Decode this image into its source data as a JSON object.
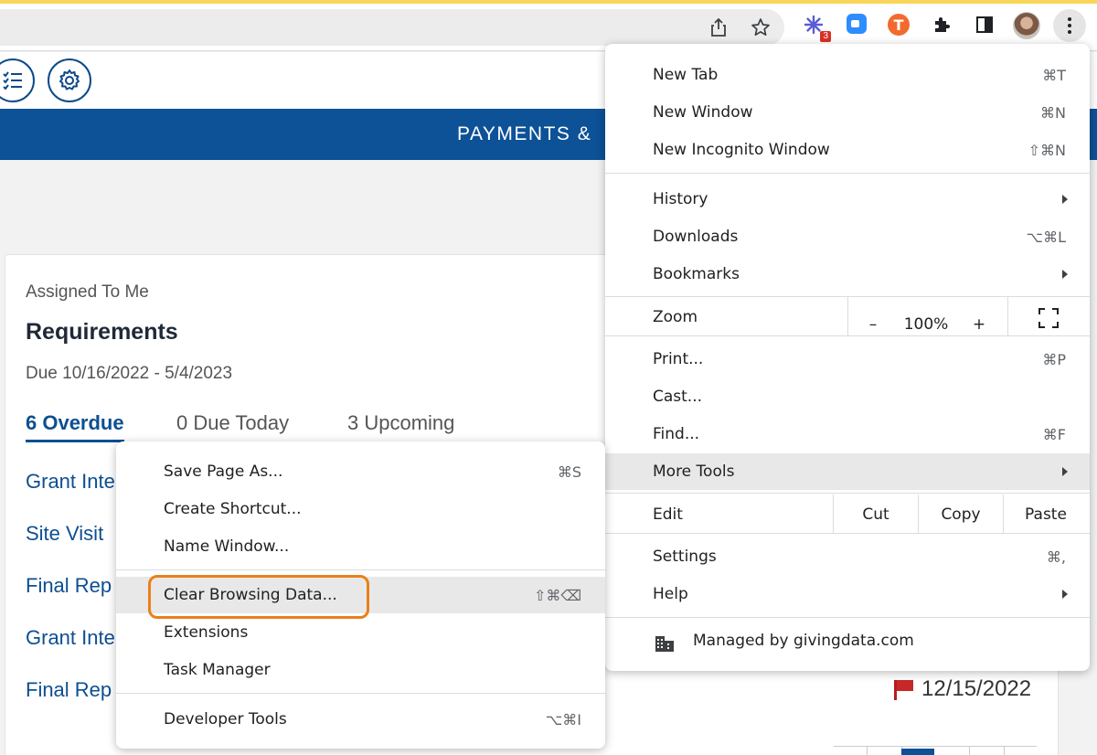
{
  "browser": {
    "extension_badge": "3",
    "extension_letter": "T"
  },
  "page": {
    "banner_title": "PAYMENTS &",
    "assigned_label": "Assigned To Me",
    "section_title": "Requirements",
    "due_range": "Due 10/16/2022 - 5/4/2023",
    "tabs": [
      "6 Overdue",
      "0 Due Today",
      "3 Upcoming"
    ],
    "items": [
      "Grant Inte",
      "Site Visit",
      "Final Rep",
      "Grant Inte",
      "Final Rep"
    ],
    "flag_date": "12/15/2022"
  },
  "menu": {
    "new_tab": {
      "label": "New Tab",
      "shortcut": "⌘T"
    },
    "new_window": {
      "label": "New Window",
      "shortcut": "⌘N"
    },
    "new_incognito": {
      "label": "New Incognito Window",
      "shortcut": "⇧⌘N"
    },
    "history": {
      "label": "History"
    },
    "downloads": {
      "label": "Downloads",
      "shortcut": "⌥⌘L"
    },
    "bookmarks": {
      "label": "Bookmarks"
    },
    "zoom": {
      "label": "Zoom",
      "minus": "–",
      "level": "100%",
      "plus": "+"
    },
    "print": {
      "label": "Print...",
      "shortcut": "⌘P"
    },
    "cast": {
      "label": "Cast..."
    },
    "find": {
      "label": "Find...",
      "shortcut": "⌘F"
    },
    "more_tools": {
      "label": "More Tools"
    },
    "edit": {
      "label": "Edit",
      "cut": "Cut",
      "copy": "Copy",
      "paste": "Paste"
    },
    "settings": {
      "label": "Settings",
      "shortcut": "⌘,"
    },
    "help": {
      "label": "Help"
    },
    "managed": "Managed by givingdata.com"
  },
  "submenu": {
    "save_page": {
      "label": "Save Page As...",
      "shortcut": "⌘S"
    },
    "create_shortcut": {
      "label": "Create Shortcut..."
    },
    "name_window": {
      "label": "Name Window..."
    },
    "clear_browsing": {
      "label": "Clear Browsing Data...",
      "shortcut": "⇧⌘⌫"
    },
    "extensions": {
      "label": "Extensions"
    },
    "task_manager": {
      "label": "Task Manager"
    },
    "developer_tools": {
      "label": "Developer Tools",
      "shortcut": "⌥⌘I"
    }
  },
  "colors": {
    "brand_blue": "#0d5196",
    "highlight_orange": "#e8801a",
    "flag_red": "#c62828"
  }
}
